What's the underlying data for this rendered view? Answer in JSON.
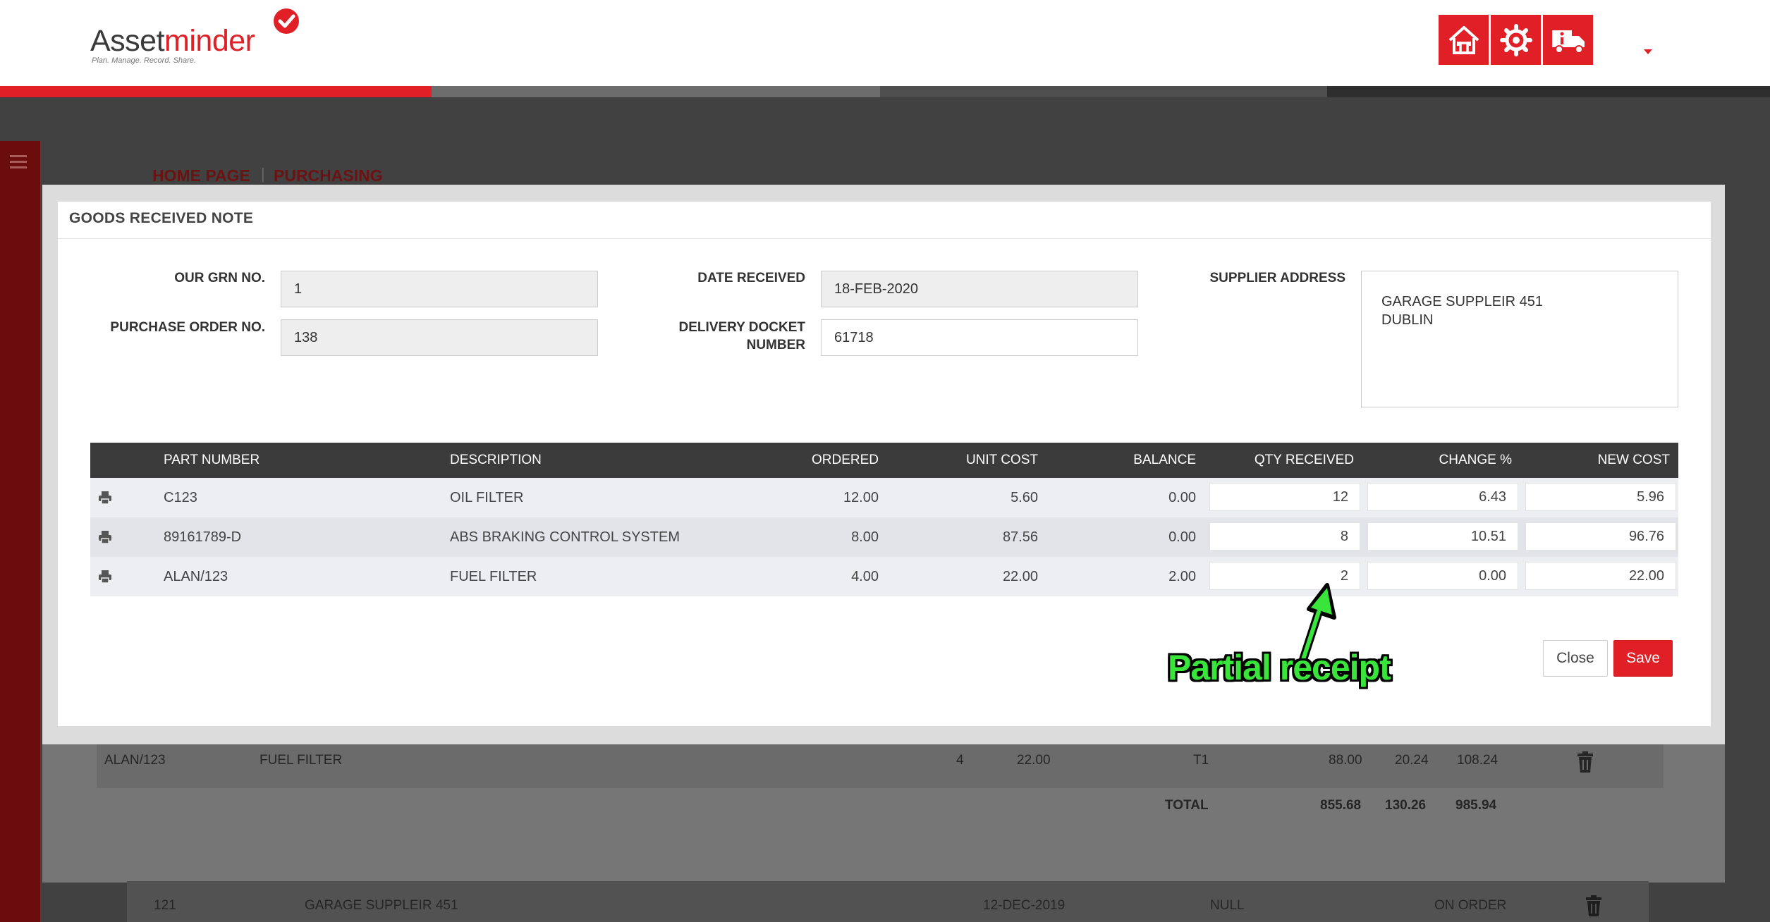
{
  "brand": {
    "logo_asset": "Asset",
    "logo_minder": "minder",
    "tagline": "Plan. Manage. Record. Share."
  },
  "header": {
    "buttons": [
      {
        "icon": "home-icon"
      },
      {
        "icon": "gear-icon"
      },
      {
        "icon": "truck-info-icon"
      }
    ],
    "colors": {
      "accent": "#e01f26",
      "stripe_red": "#e01f26",
      "stripe_mid": "#6d6d6d",
      "stripe_dark": "#2e2e2e"
    }
  },
  "breadcrumb": {
    "home": "HOME PAGE",
    "current": "PURCHASING"
  },
  "background": {
    "row": {
      "part": "ALAN/123",
      "description": "FUEL FILTER",
      "qty": "4",
      "unit_cost": "22.00",
      "tax_code": "T1",
      "net": "88.00",
      "vat": "20.24",
      "gross": "108.24"
    },
    "totals": {
      "label": "TOTAL",
      "net": "855.68",
      "vat": "130.26",
      "gross": "985.94"
    },
    "order_row": {
      "id": "121",
      "supplier": "GARAGE SUPPLEIR 451",
      "date": "12-DEC-2019",
      "field": "NULL",
      "status": "ON ORDER"
    }
  },
  "modal": {
    "title": "GOODS RECEIVED NOTE",
    "fields": {
      "grn_label": "OUR GRN NO.",
      "grn_value": "1",
      "po_label": "PURCHASE ORDER NO.",
      "po_value": "138",
      "date_label": "DATE RECEIVED",
      "date_value": "18-FEB-2020",
      "docket_label_1": "DELIVERY DOCKET",
      "docket_label_2": "NUMBER",
      "docket_value": "61718",
      "supplier_label": "SUPPLIER ADDRESS",
      "supplier_line1": "GARAGE SUPPLEIR 451",
      "supplier_line2": "DUBLIN"
    },
    "table": {
      "headers": {
        "part": "PART NUMBER",
        "description": "DESCRIPTION",
        "ordered": "ORDERED",
        "unit_cost": "UNIT COST",
        "balance": "BALANCE",
        "qty_received": "QTY RECEIVED",
        "change": "CHANGE %",
        "new_cost": "NEW COST"
      },
      "rows": [
        {
          "part": "C123",
          "description": "OIL FILTER",
          "ordered": "12.00",
          "unit_cost": "5.60",
          "balance": "0.00",
          "qty_received": "12",
          "change": "6.43",
          "new_cost": "5.96"
        },
        {
          "part": "89161789-D",
          "description": "ABS BRAKING CONTROL SYSTEM",
          "ordered": "8.00",
          "unit_cost": "87.56",
          "balance": "0.00",
          "qty_received": "8",
          "change": "10.51",
          "new_cost": "96.76"
        },
        {
          "part": "ALAN/123",
          "description": "FUEL FILTER",
          "ordered": "4.00",
          "unit_cost": "22.00",
          "balance": "2.00",
          "qty_received": "2",
          "change": "0.00",
          "new_cost": "22.00"
        }
      ]
    },
    "buttons": {
      "close": "Close",
      "save": "Save"
    }
  },
  "annotation": {
    "text": "Partial receipt",
    "color": "#39e43b"
  }
}
